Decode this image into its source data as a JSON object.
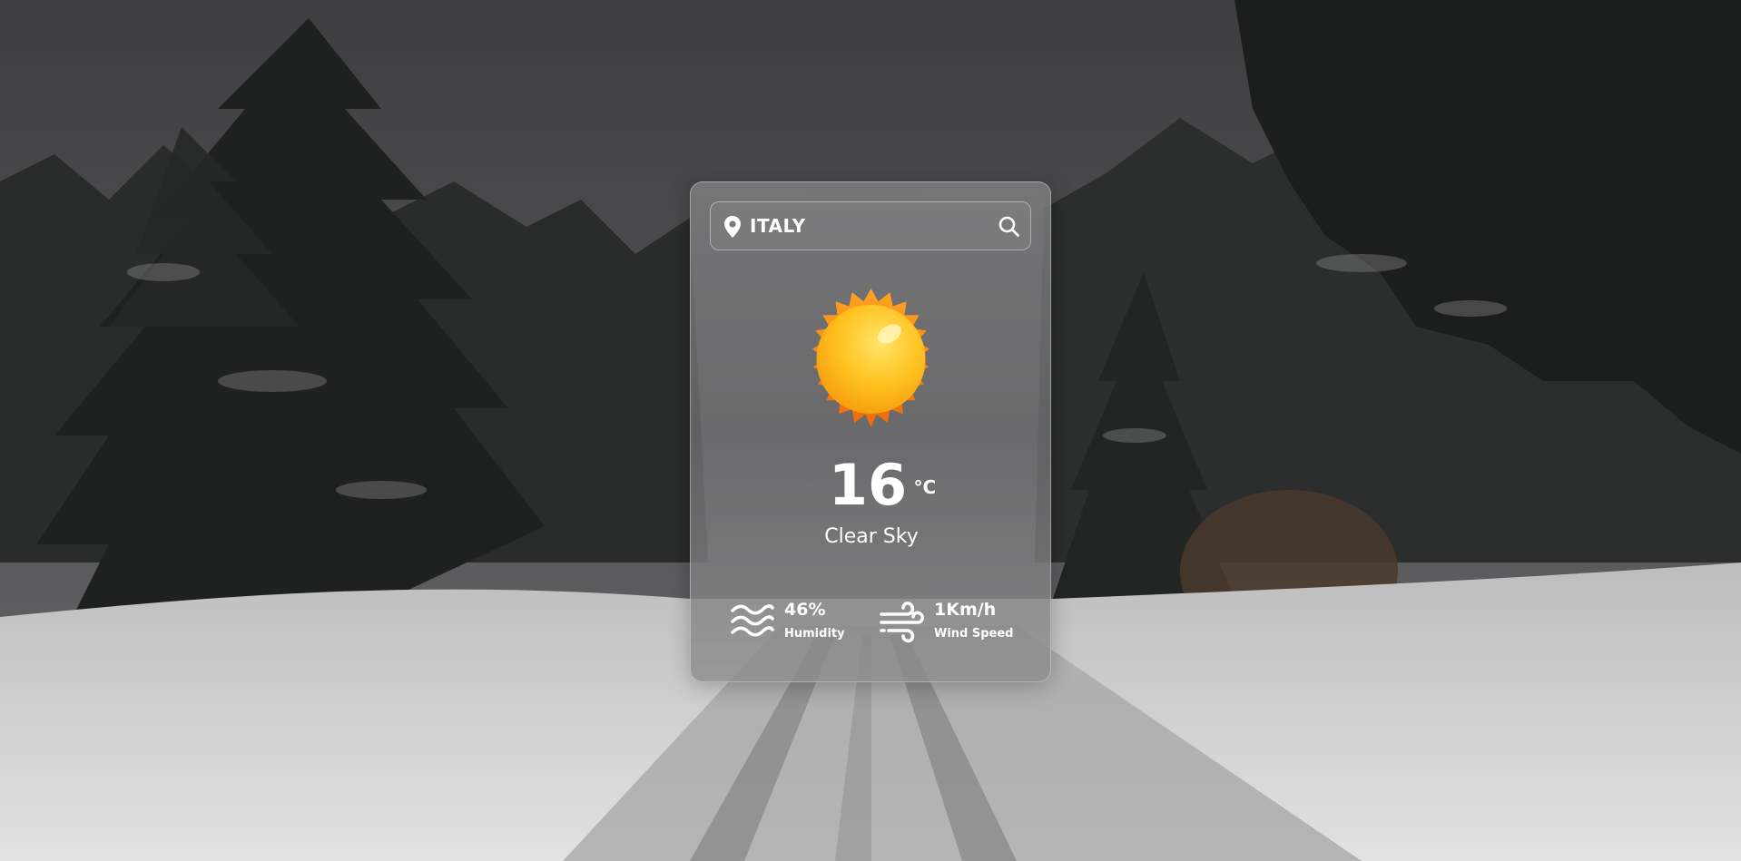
{
  "search": {
    "city": "ITALY",
    "pin_icon": "map-pin-icon",
    "search_icon": "search-icon"
  },
  "weather": {
    "icon": "sun-icon",
    "temperature": "16",
    "unit": "°C",
    "condition": "Clear Sky"
  },
  "details": {
    "humidity": {
      "icon": "waves-icon",
      "value": "46%",
      "label": "Humidity"
    },
    "wind": {
      "icon": "wind-icon",
      "value": "1Km/h",
      "label": "Wind Speed"
    }
  },
  "colors": {
    "text": "#ffffff",
    "sun_outer": "#f57d0d",
    "sun_inner": "#ffc21f"
  }
}
